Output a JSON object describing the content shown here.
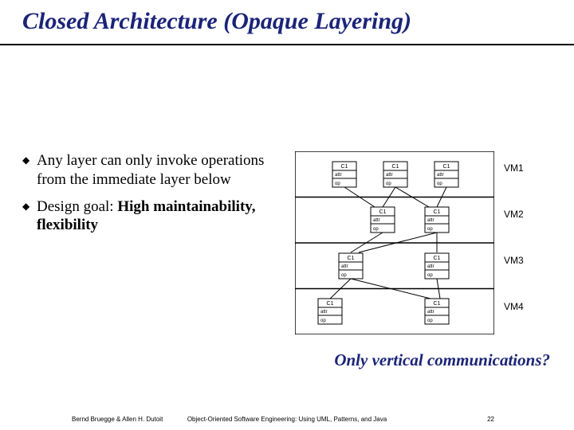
{
  "title": "Closed Architecture (Opaque Layering)",
  "bullets": [
    {
      "pre": "Any layer can only invoke operations from the immediate layer below",
      "bold": "",
      "post": ""
    },
    {
      "pre": "Design goal: ",
      "bold": "High maintainability, flexibility",
      "post": ""
    }
  ],
  "class_box": {
    "name": "C1",
    "attr": "attr",
    "op": "op"
  },
  "vm_labels": [
    "VM1",
    "VM2",
    "VM3",
    "VM4"
  ],
  "callout": "Only vertical communications?",
  "footer": {
    "left": "Bernd Bruegge & Allen H. Dutoit",
    "mid": "Object-Oriented Software Engineering: Using UML, Patterns, and Java",
    "right": "22"
  }
}
